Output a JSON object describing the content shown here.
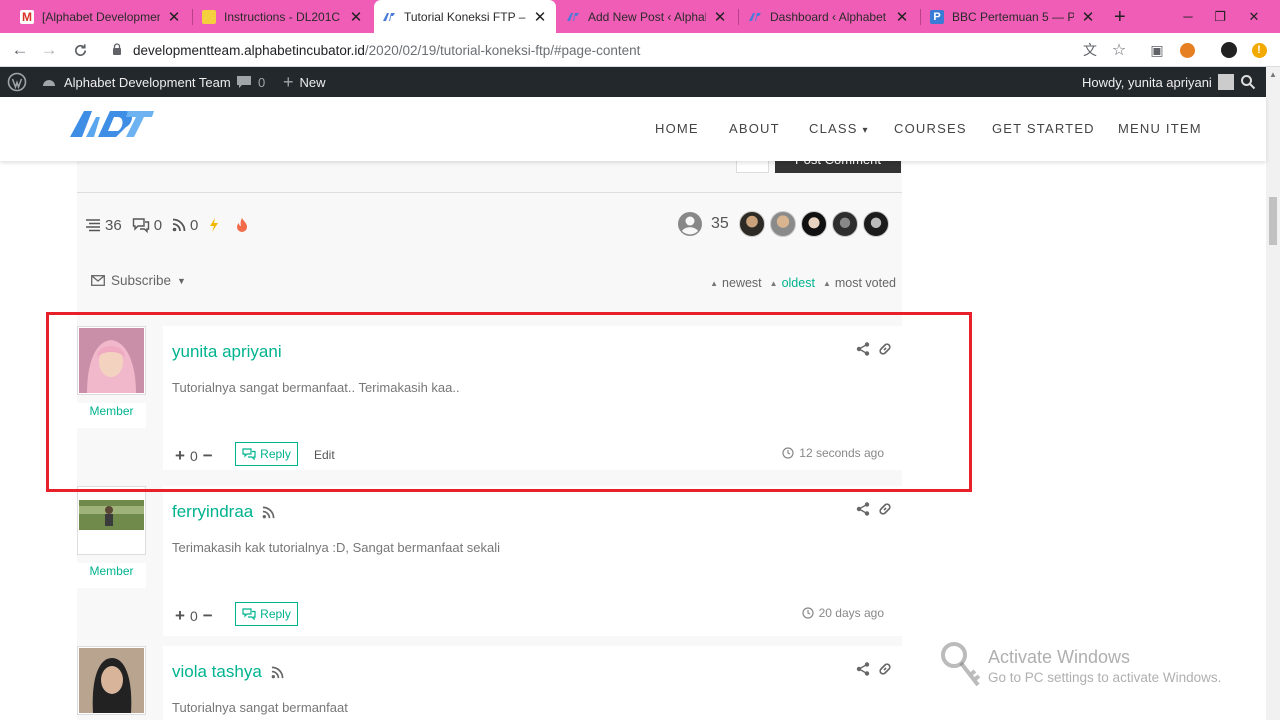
{
  "browser": {
    "tabs": [
      {
        "title": "[Alphabet Development",
        "fav_color": "#d93025",
        "fav_letter": "M"
      },
      {
        "title": "Instructions - DL201C - S",
        "fav_color": "#f4d03f",
        "fav_letter": ""
      },
      {
        "title": "Tutorial Koneksi FTP – Al",
        "fav_color": "#4a7bd8",
        "fav_letter": ""
      },
      {
        "title": "Add New Post ‹ Alphabe",
        "fav_color": "#4a7bd8",
        "fav_letter": ""
      },
      {
        "title": "Dashboard ‹ Alphabet D",
        "fav_color": "#4a7bd8",
        "fav_letter": ""
      },
      {
        "title": "BBC Pertemuan 5 — Pos",
        "fav_color": "#3a7bd5",
        "fav_letter": "P"
      }
    ],
    "new_tab": "+",
    "url_host": "developmentteam.alphabetincubator.id",
    "url_path": "/2020/02/19/tutorial-koneksi-ftp/#page-content"
  },
  "adminbar": {
    "site_name": "Alphabet Development Team",
    "comments_count": "0",
    "new_label": "New",
    "howdy": "Howdy, yunita apriyani"
  },
  "site": {
    "menu": [
      "HOME",
      "ABOUT",
      "CLASS",
      "COURSES",
      "GET STARTED",
      "MENU ITEM"
    ],
    "class_arrow": "▾"
  },
  "post_area": {
    "post_comment_label": "Post Comment",
    "stats": {
      "threads": "36",
      "replies": "0",
      "followers_rss": "0"
    },
    "followers_count": "35",
    "subscribe_label": "Subscribe",
    "sort": {
      "newest": "newest",
      "oldest": "oldest",
      "most_voted": "most voted"
    }
  },
  "comments": [
    {
      "author": "yunita apriyani",
      "role": "Member",
      "text": "Tutorialnya sangat bermanfaat.. Terimakasih kaa..",
      "votes": "0",
      "reply_label": "Reply",
      "edit_label": "Edit",
      "time": "12 seconds ago",
      "rss": false
    },
    {
      "author": "ferryindraa",
      "role": "Member",
      "text": "Terimakasih kak tutorialnya :D, Sangat bermanfaat sekali",
      "votes": "0",
      "reply_label": "Reply",
      "time": "20 days ago",
      "rss": true
    },
    {
      "author": "viola tashya",
      "text": "Tutorialnya sangat bermanfaat",
      "rss": true
    }
  ],
  "watermark": {
    "line1": "Activate Windows",
    "line2": "Go to PC settings to activate Windows."
  },
  "colors": {
    "accent": "#00b38f",
    "highlight": "#e8202a",
    "tabstrip": "#ef5db6"
  }
}
